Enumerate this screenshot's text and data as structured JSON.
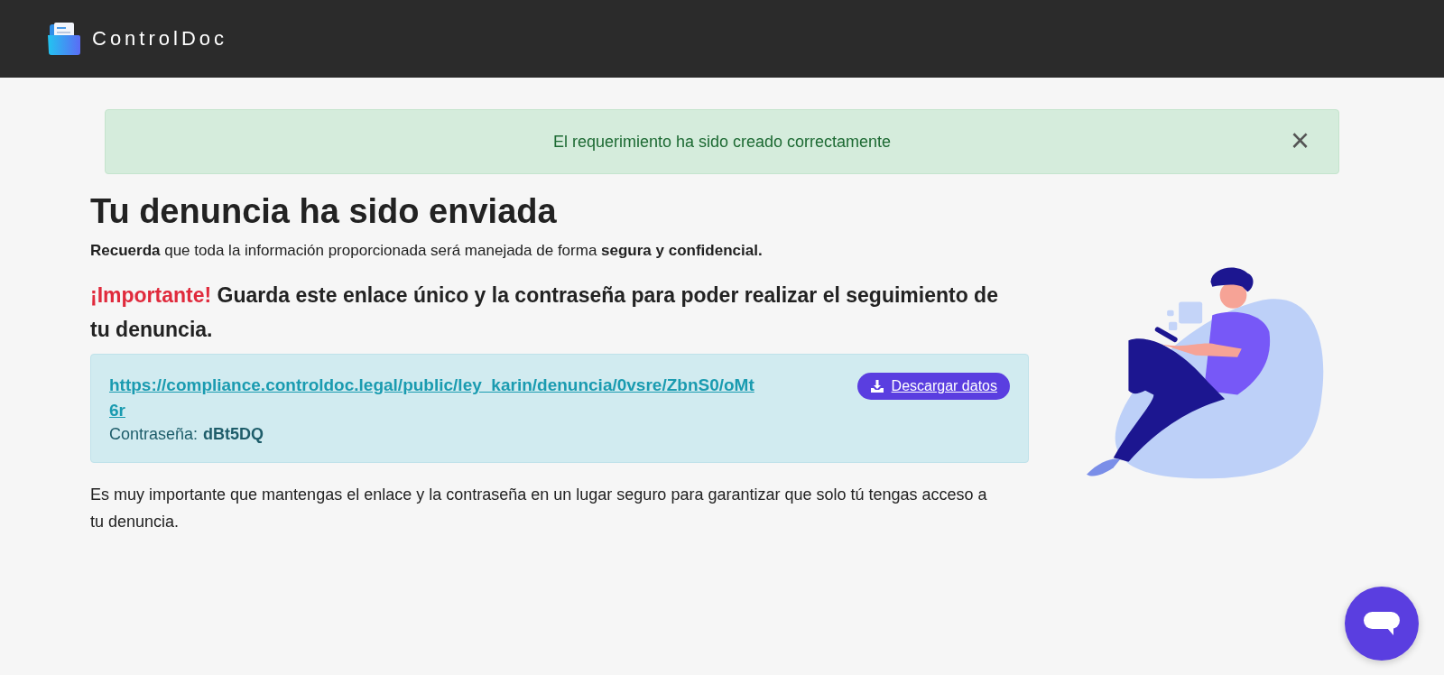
{
  "header": {
    "brand": "ControlDoc"
  },
  "alert": {
    "message": "El requerimiento ha sido creado correctamente",
    "close": "×"
  },
  "title": "Tu denuncia ha sido enviada",
  "reminder": "**Recuerda** que toda la información proporcionada será manejada de forma **segura y confidencial.**",
  "important": {
    "label": "¡Importante!",
    "text": "Guarda este enlace único y la contraseña para poder realizar el seguimiento de tu denuncia."
  },
  "credentials": {
    "link": "https://compliance.controldoc.legal/public/ley_karin/denuncia/0vsre/ZbnS0/oMt6r",
    "password_label": "Contraseña:",
    "password": "dBt5DQ",
    "download_button": "Descargar datos"
  },
  "note": "Es muy importante que mantengas el enlace y la contraseña en un lugar seguro para garantizar que solo tú tengas acceso a tu denuncia."
}
